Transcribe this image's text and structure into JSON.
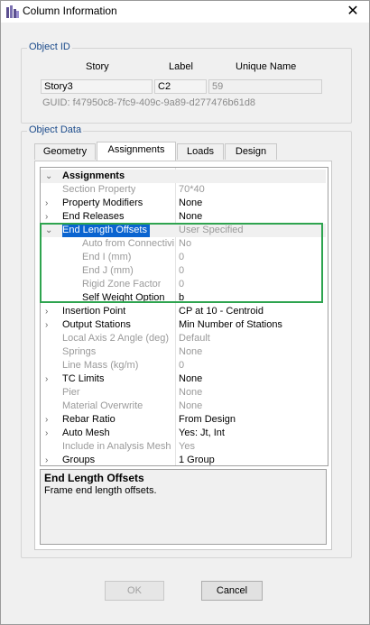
{
  "window": {
    "title": "Column Information",
    "close_glyph": "✕"
  },
  "object_id": {
    "group_title": "Object ID",
    "headers": {
      "story": "Story",
      "label": "Label",
      "unique_name": "Unique Name"
    },
    "story": "Story3",
    "label": "C2",
    "unique_name": "59",
    "guid": "GUID: f47950c8-7fc9-409c-9a89-d277476b61d8"
  },
  "object_data": {
    "group_title": "Object Data",
    "tabs": [
      {
        "label": "Geometry",
        "active": false
      },
      {
        "label": "Assignments",
        "active": true
      },
      {
        "label": "Loads",
        "active": false
      },
      {
        "label": "Design",
        "active": false
      }
    ]
  },
  "grid": {
    "rows": [
      {
        "name": "Assignments",
        "value": "",
        "expander": "⌄",
        "kind": "header"
      },
      {
        "name": "Section Property",
        "value": "70*40",
        "expander": "",
        "kind": "gray"
      },
      {
        "name": "Property Modifiers",
        "value": "None",
        "expander": "›",
        "kind": "normal"
      },
      {
        "name": "End Releases",
        "value": "None",
        "expander": "›",
        "kind": "normal"
      },
      {
        "name": "End Length Offsets",
        "value": "User Specified",
        "expander": "⌄",
        "kind": "selected"
      },
      {
        "name": "Auto from Connectivity",
        "value": "No",
        "expander": "",
        "kind": "gray-child"
      },
      {
        "name": "End I (mm)",
        "value": "0",
        "expander": "",
        "kind": "gray-child"
      },
      {
        "name": "End J (mm)",
        "value": "0",
        "expander": "",
        "kind": "gray-child"
      },
      {
        "name": "Rigid Zone Factor",
        "value": "0",
        "expander": "",
        "kind": "gray-child"
      },
      {
        "name": "Self Weight Option",
        "value": "b",
        "expander": "",
        "kind": "child"
      },
      {
        "name": "Insertion Point",
        "value": "CP at 10 - Centroid",
        "expander": "›",
        "kind": "normal"
      },
      {
        "name": "Output Stations",
        "value": "Min Number of Stations",
        "expander": "›",
        "kind": "normal"
      },
      {
        "name": "Local Axis 2 Angle (deg)",
        "value": "Default",
        "expander": "",
        "kind": "gray"
      },
      {
        "name": "Springs",
        "value": "None",
        "expander": "",
        "kind": "gray"
      },
      {
        "name": "Line Mass (kg/m)",
        "value": "0",
        "expander": "",
        "kind": "gray"
      },
      {
        "name": "TC Limits",
        "value": "None",
        "expander": "›",
        "kind": "normal"
      },
      {
        "name": "Pier",
        "value": "None",
        "expander": "",
        "kind": "gray"
      },
      {
        "name": "Material Overwrite",
        "value": "None",
        "expander": "",
        "kind": "gray"
      },
      {
        "name": "Rebar Ratio",
        "value": "From Design",
        "expander": "›",
        "kind": "normal"
      },
      {
        "name": "Auto Mesh",
        "value": "Yes: Jt, Int",
        "expander": "›",
        "kind": "normal"
      },
      {
        "name": "Include in Analysis Mesh",
        "value": "Yes",
        "expander": "",
        "kind": "gray"
      },
      {
        "name": "Groups",
        "value": "1 Group",
        "expander": "›",
        "kind": "normal"
      }
    ]
  },
  "description": {
    "title": "End Length Offsets",
    "body": "Frame end length offsets."
  },
  "buttons": {
    "ok": "OK",
    "cancel": "Cancel"
  },
  "colors": {
    "selection": "#0a64d0",
    "highlight_box": "#2ea44f",
    "group_title": "#1a4a8a"
  }
}
